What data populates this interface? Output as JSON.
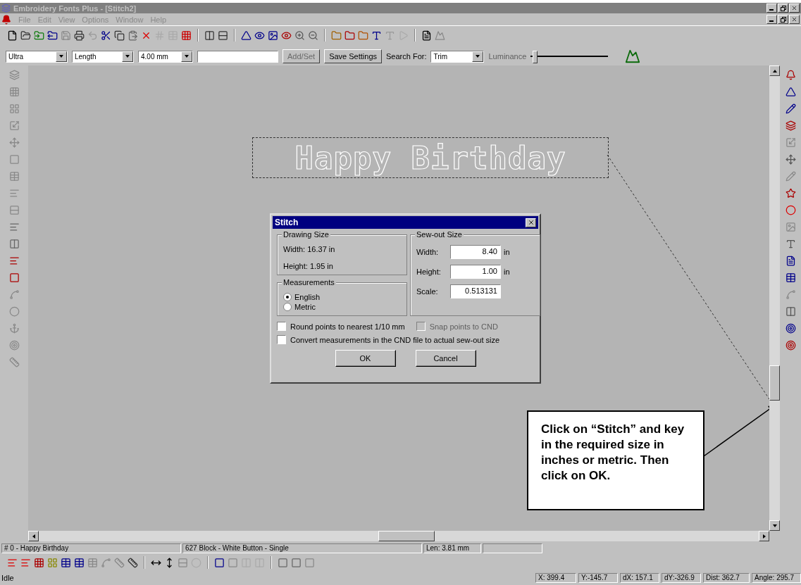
{
  "window": {
    "title": "Embroidery Fonts Plus - [Stitch2]"
  },
  "menu": [
    "File",
    "Edit",
    "View",
    "Options",
    "Window",
    "Help"
  ],
  "options_bar": {
    "combos": [
      {
        "value": "Ultra"
      },
      {
        "value": "Length"
      },
      {
        "value": "4.00 mm"
      }
    ],
    "buttons": [
      {
        "label": "Add/Set",
        "disabled": true
      },
      {
        "label": "Save Settings",
        "disabled": false
      }
    ],
    "search_label": "Search For:",
    "search_value": "Trim",
    "slider": {
      "label": "Luminance",
      "disabled": true,
      "level": 0.02
    }
  },
  "canvas": {
    "design_text": "Happy Birthday"
  },
  "dialog": {
    "title": "Stitch",
    "drawing_size": {
      "title": "Drawing Size",
      "width": "Width:  16.37 in",
      "height": "Height:  1.95 in"
    },
    "measurements": {
      "title": "Measurements",
      "options": [
        {
          "label": "English",
          "selected": true
        },
        {
          "label": "Metric",
          "selected": false
        }
      ]
    },
    "sewout": {
      "title": "Sew-out Size",
      "fields": [
        {
          "label": "Width:",
          "value": "8.40",
          "unit": "in"
        },
        {
          "label": "Height:",
          "value": "1.00",
          "unit": "in"
        },
        {
          "label": "Scale:",
          "value": "0.513131"
        }
      ]
    },
    "checkboxes": [
      {
        "label": "Round points to nearest 1/10 mm",
        "checked": false,
        "disabled": false
      },
      {
        "label": "Snap points to CND",
        "checked": false,
        "disabled": true
      },
      {
        "label": "Convert measurements in the CND file to actual sew-out size",
        "checked": false,
        "disabled": false
      }
    ],
    "buttons": [
      "OK",
      "Cancel"
    ]
  },
  "callout": {
    "text": "Click on “Stitch” and key in the required size in inches or metric. Then click on OK."
  },
  "status": {
    "object": "# 0 - Happy Birthday",
    "stitch": "627 Block - White Button - Single",
    "length": "Len: 3.81 mm"
  },
  "status_bar": {
    "message": "Idle",
    "coords": [
      "X: 399.4",
      "Y:-145.7",
      "dX: 157.1",
      "dY:-326.9",
      "Dist: 362.7",
      "Angle: 295.7"
    ]
  }
}
